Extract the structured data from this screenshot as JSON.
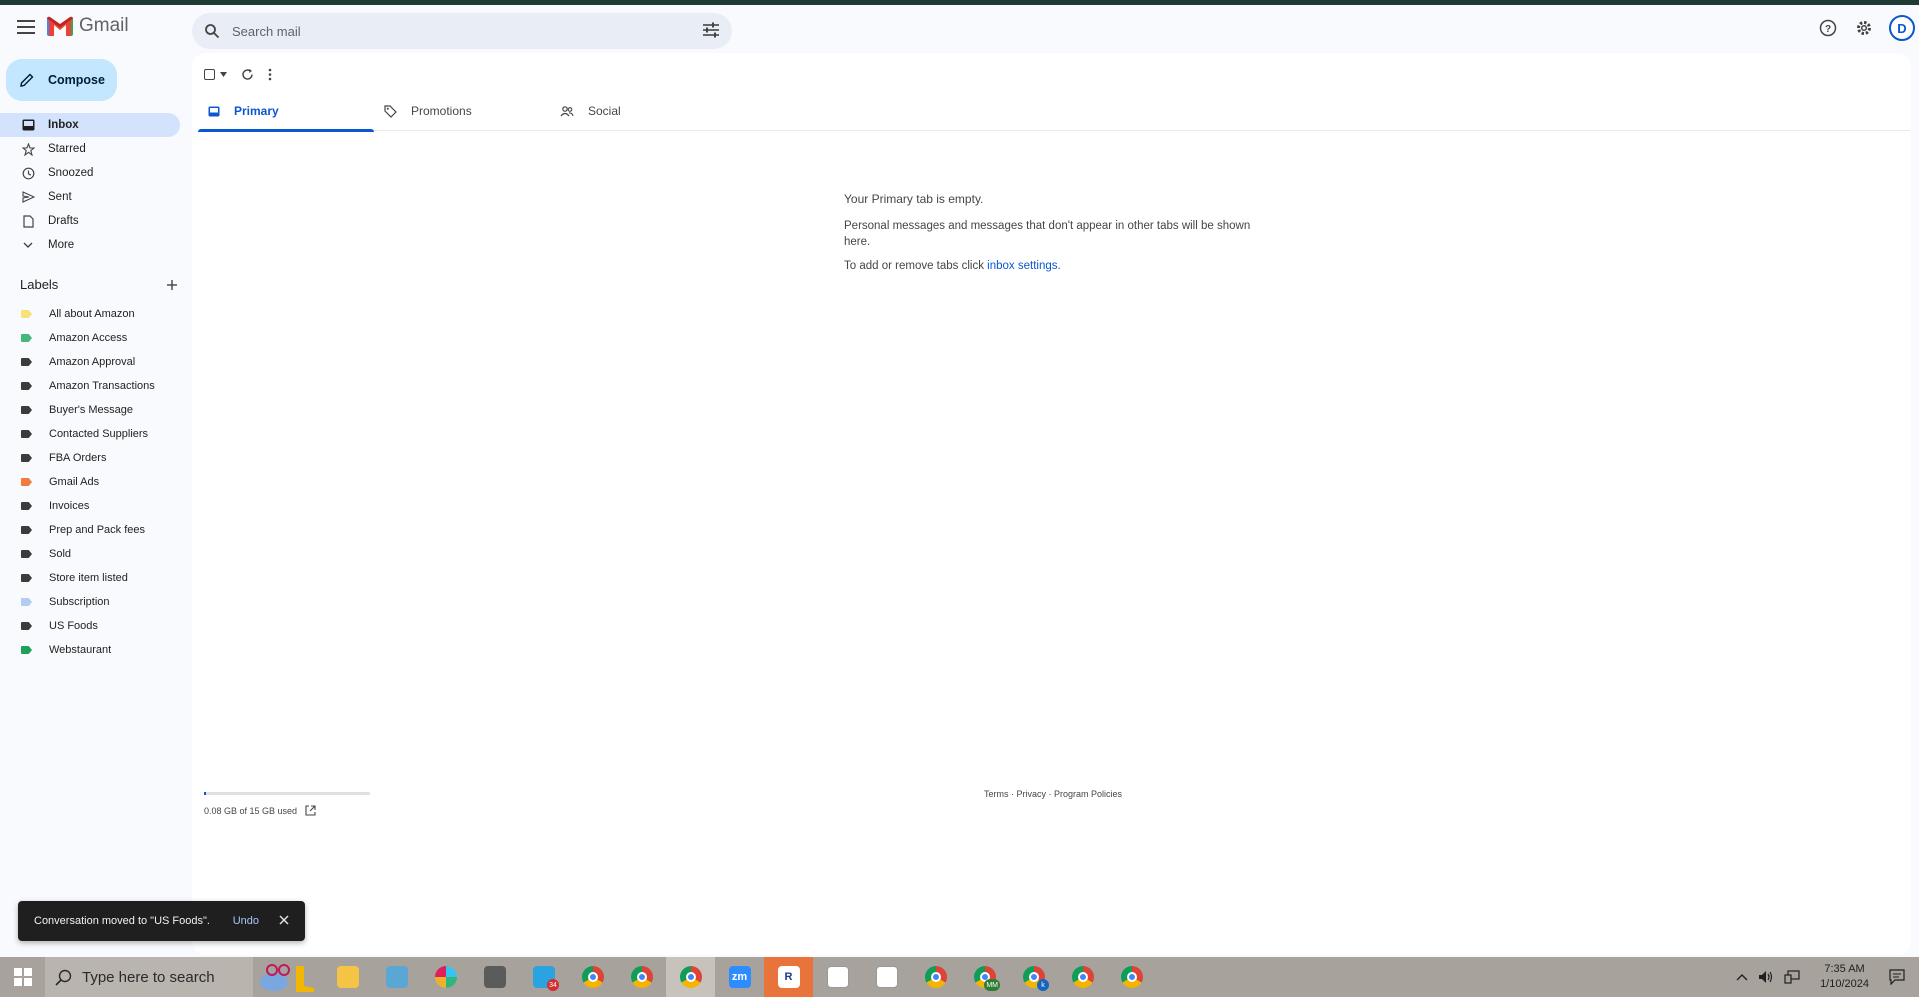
{
  "app": {
    "name": "Gmail"
  },
  "search": {
    "placeholder": "Search mail"
  },
  "header": {
    "avatar_initial": "D"
  },
  "compose": {
    "label": "Compose"
  },
  "nav": [
    {
      "label": "Inbox",
      "icon": "inbox-icon",
      "active": true
    },
    {
      "label": "Starred",
      "icon": "star-icon"
    },
    {
      "label": "Snoozed",
      "icon": "clock-icon"
    },
    {
      "label": "Sent",
      "icon": "send-icon"
    },
    {
      "label": "Drafts",
      "icon": "draft-icon"
    },
    {
      "label": "More",
      "icon": "chevron-down-icon"
    }
  ],
  "labels": {
    "heading": "Labels",
    "items": [
      {
        "name": "All about Amazon",
        "color": "#f7e27a"
      },
      {
        "name": "Amazon Access",
        "color": "#43b87a"
      },
      {
        "name": "Amazon Approval",
        "color": "#3c3c3c"
      },
      {
        "name": "Amazon Transactions",
        "color": "#3c3c3c"
      },
      {
        "name": "Buyer's Message",
        "color": "#3c3c3c"
      },
      {
        "name": "Contacted Suppliers",
        "color": "#3c3c3c"
      },
      {
        "name": "FBA Orders",
        "color": "#3c3c3c"
      },
      {
        "name": "Gmail Ads",
        "color": "#f07b3f"
      },
      {
        "name": "Invoices",
        "color": "#3c3c3c"
      },
      {
        "name": "Prep and Pack fees",
        "color": "#3c3c3c"
      },
      {
        "name": "Sold",
        "color": "#3c3c3c"
      },
      {
        "name": "Store item listed",
        "color": "#3c3c3c"
      },
      {
        "name": "Subscription",
        "color": "#b3ccef"
      },
      {
        "name": "US Foods",
        "color": "#3c3c3c"
      },
      {
        "name": "Webstaurant",
        "color": "#20a05a"
      }
    ]
  },
  "tabs": [
    {
      "label": "Primary",
      "icon": "inbox-icon",
      "active": true
    },
    {
      "label": "Promotions",
      "icon": "tag-icon"
    },
    {
      "label": "Social",
      "icon": "people-icon"
    }
  ],
  "empty_state": {
    "title": "Your Primary tab is empty.",
    "line1": "Personal messages and messages that don't appear in other tabs will be shown here.",
    "line2_prefix": "To add or remove tabs click ",
    "line2_link": "inbox settings",
    "line2_suffix": "."
  },
  "storage": {
    "text": "0.08 GB of 15 GB used",
    "fraction": 0.005
  },
  "footer": {
    "terms": "Terms",
    "privacy": "Privacy",
    "policies": "Program Policies",
    "sep": " · "
  },
  "toast": {
    "message": "Conversation moved to \"US Foods\".",
    "undo": "Undo"
  },
  "taskbar": {
    "search_placeholder": "Type here to search",
    "time": "7:35 AM",
    "date": "1/10/2024",
    "badge_count": "34",
    "apps": [
      {
        "name": "file-explorer-icon"
      },
      {
        "name": "notepad-icon"
      },
      {
        "name": "slack-icon"
      },
      {
        "name": "calculator-icon"
      },
      {
        "name": "telegram-icon",
        "badge": "34"
      },
      {
        "name": "chrome-icon"
      },
      {
        "name": "chrome-profile-icon"
      },
      {
        "name": "chrome-k-icon",
        "active": true
      },
      {
        "name": "zoom-icon",
        "label": "zm"
      },
      {
        "name": "r-app-icon",
        "label": "R"
      },
      {
        "name": "chart-app-icon"
      },
      {
        "name": "chart-app-2-icon"
      },
      {
        "name": "chrome-red-icon"
      },
      {
        "name": "chrome-mm-icon",
        "badge": "MM"
      },
      {
        "name": "chrome-k2-icon",
        "badge": "k"
      },
      {
        "name": "chrome-green-icon"
      },
      {
        "name": "chrome-person-icon"
      }
    ]
  }
}
